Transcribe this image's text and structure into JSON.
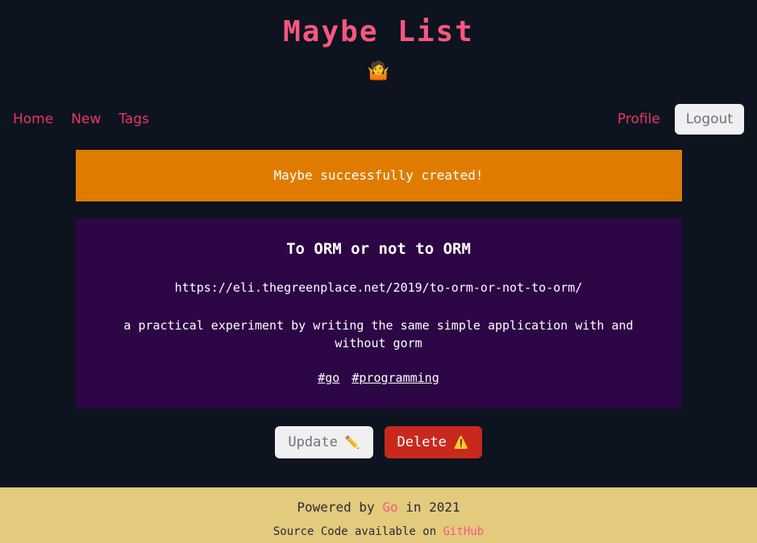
{
  "header": {
    "title": "Maybe List",
    "emoji": "🤷",
    "emoji_name": "person-shrugging-emoji"
  },
  "nav": {
    "left_links": [
      {
        "label": "Home",
        "name": "nav-link-home"
      },
      {
        "label": "New",
        "name": "nav-link-new"
      },
      {
        "label": "Tags",
        "name": "nav-link-tags"
      }
    ],
    "profile_label": "Profile",
    "logout_label": "Logout"
  },
  "alert": {
    "message": "Maybe successfully created!",
    "color": "#df7c00"
  },
  "card": {
    "title": "To ORM or not to ORM",
    "url": "https://eli.thegreenplace.net/2019/to-orm-or-not-to-orm/",
    "description": "a practical experiment by writing the same simple application with and without gorm",
    "tags": [
      {
        "label": "#go",
        "name": "tag-link-go"
      },
      {
        "label": "#programming",
        "name": "tag-link-programming"
      }
    ],
    "background": "#2d0645"
  },
  "actions": {
    "update_label": "Update",
    "update_icon": "✏️",
    "delete_label": "Delete",
    "delete_icon": "⚠️",
    "delete_color": "#c9281d"
  },
  "footer": {
    "powered_prefix": "Powered by ",
    "powered_accent": "Go",
    "powered_suffix": " in 2021",
    "source_prefix": "Source Code available on ",
    "source_accent": "GitHub",
    "background": "#e3ca7c"
  }
}
